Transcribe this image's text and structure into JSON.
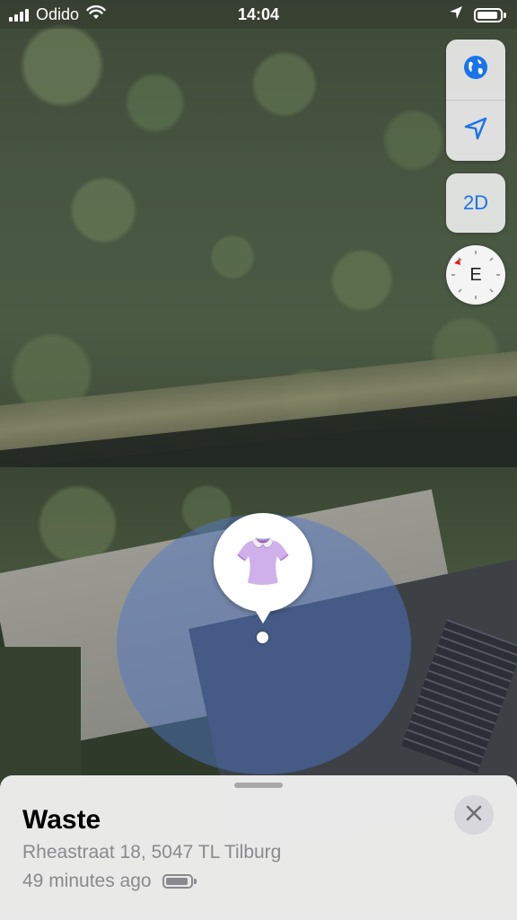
{
  "status_bar": {
    "carrier": "Odido",
    "time": "14:04",
    "icons": [
      "signal-icon",
      "wifi-icon",
      "location-arrow-icon",
      "battery-icon"
    ]
  },
  "map": {
    "type": "satellite",
    "controls": {
      "globe_icon": "globe-icon",
      "location_icon": "location-arrow-icon",
      "view_mode_label": "2D",
      "compass_heading": "E"
    },
    "pin": {
      "emoji": "👚",
      "accuracy_circle_color": "#5078c8"
    }
  },
  "sheet": {
    "title": "Waste",
    "address": "Rheastraat 18, 5047 TL Tilburg",
    "last_seen": "49 minutes ago",
    "battery_icon": "battery-icon",
    "close_icon": "close-icon"
  },
  "colors": {
    "accent": "#1a73e8"
  }
}
